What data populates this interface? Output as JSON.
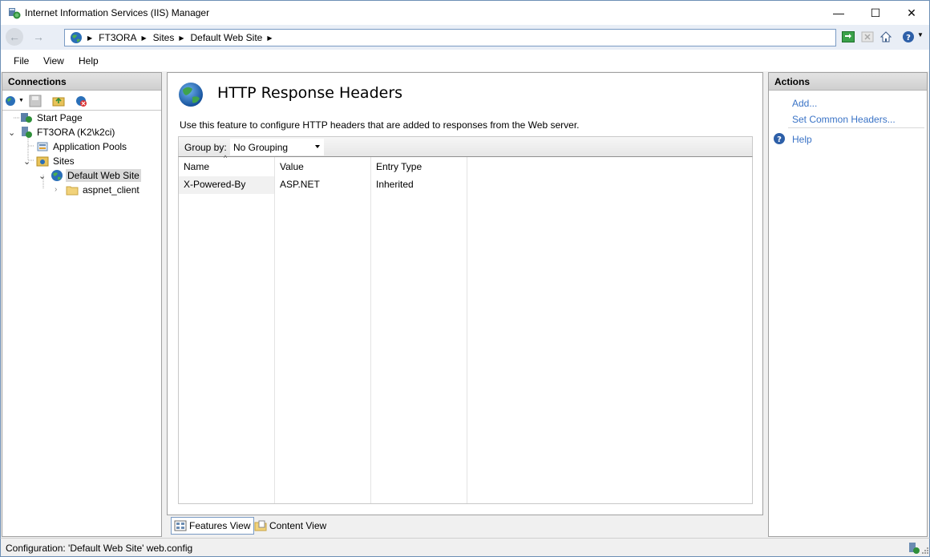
{
  "window": {
    "title": "Internet Information Services (IIS) Manager",
    "minimize": "—",
    "maximize": "☐",
    "close": "✕"
  },
  "address": {
    "crumbs": [
      "FT3ORA",
      "Sites",
      "Default Web Site"
    ]
  },
  "menu": [
    "File",
    "View",
    "Help"
  ],
  "connections": {
    "header": "Connections",
    "tree": {
      "start_page": "Start Page",
      "server": "FT3ORA (K2\\k2ci)",
      "app_pools": "Application Pools",
      "sites": "Sites",
      "default_site": "Default Web Site",
      "aspnet_client": "aspnet_client"
    }
  },
  "feature": {
    "title": "HTTP Response Headers",
    "description": "Use this feature to configure HTTP headers that are added to responses from the Web server.",
    "group_by_label": "Group by:",
    "group_by_value": "No Grouping",
    "columns": [
      "Name",
      "Value",
      "Entry Type"
    ],
    "rows": [
      {
        "name": "X-Powered-By",
        "value": "ASP.NET",
        "entry_type": "Inherited"
      }
    ]
  },
  "view_tabs": {
    "features": "Features View",
    "content": "Content View"
  },
  "actions": {
    "header": "Actions",
    "add": "Add...",
    "set_common": "Set Common Headers...",
    "help": "Help"
  },
  "status": {
    "text": "Configuration: 'Default Web Site' web.config"
  },
  "colors": {
    "link": "#3a73c6",
    "accent_border": "#6d8fb5"
  }
}
